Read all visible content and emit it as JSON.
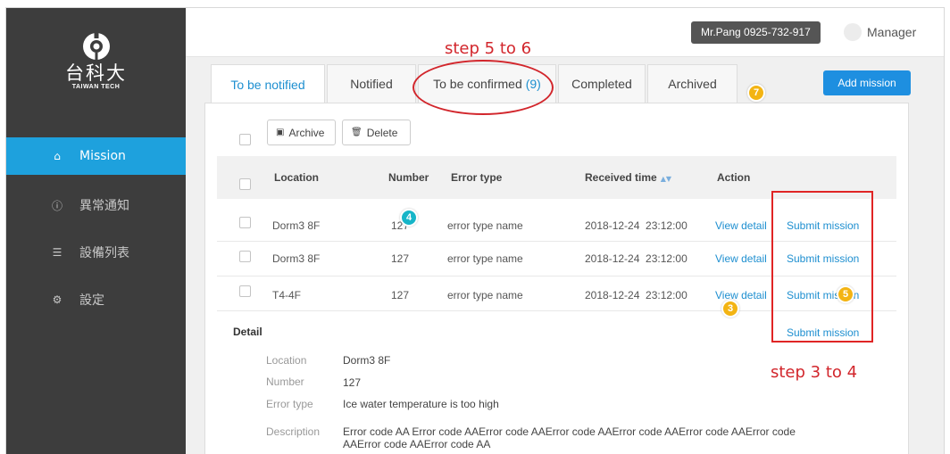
{
  "app": {
    "logo_cn": "台科大",
    "logo_en": "TAIWAN TECH"
  },
  "sidebar": {
    "items": [
      {
        "label": "Mission",
        "icon": "home-icon",
        "active": true
      },
      {
        "label": "異常通知",
        "icon": "alert-circle-icon",
        "active": false
      },
      {
        "label": "設備列表",
        "icon": "list-icon",
        "active": false
      },
      {
        "label": "設定",
        "icon": "gear-icon",
        "active": false
      }
    ]
  },
  "topbar": {
    "user": "Mr.Pang 0925-732-917",
    "role": "Manager"
  },
  "tabs": [
    {
      "label": "To be notified",
      "count": "",
      "active": true
    },
    {
      "label": "Notified",
      "count": "",
      "active": false
    },
    {
      "label": "To be confirmed",
      "count": "(9)",
      "active": false
    },
    {
      "label": "Completed",
      "count": "",
      "active": false
    },
    {
      "label": "Archived",
      "count": "",
      "active": false
    }
  ],
  "toolbar": {
    "add_label": "Add mission",
    "archive_label": "Archive",
    "delete_label": "Delete"
  },
  "table": {
    "columns": [
      "Location",
      "Number",
      "Error type",
      "Received time",
      "Action"
    ],
    "rows": [
      {
        "location": "Dorm3 8F",
        "number": "127",
        "error_type": "error type name",
        "received": "2018-12-24  23:12:00",
        "view": "View detail",
        "submit": "Submit mission"
      },
      {
        "location": "Dorm3 8F",
        "number": "127",
        "error_type": "error type name",
        "received": "2018-12-24  23:12:00",
        "view": "View detail",
        "submit": "Submit mission"
      },
      {
        "location": "T4-4F",
        "number": "127",
        "error_type": "error type name",
        "received": "2018-12-24  23:12:00",
        "view": "View detail",
        "submit": "Submit mission"
      }
    ]
  },
  "detail": {
    "title": "Detail",
    "submit": "Submit mission",
    "fields": [
      {
        "label": "Location",
        "value": "Dorm3 8F"
      },
      {
        "label": "Number",
        "value": "127"
      },
      {
        "label": "Error type",
        "value": "Ice water temperature is too high"
      },
      {
        "label": "Description",
        "value": "Error code AA Error code AAError code AAError code AAError code AAError code AAError code AAError code AAError code AA"
      }
    ]
  },
  "annotations": {
    "step_top": "step 5 to 6",
    "step_right": "step 3 to 4",
    "markers": [
      "3",
      "4",
      "5",
      "7"
    ]
  },
  "colors": {
    "sidebar_bg": "#3d3d3d",
    "accent": "#1ea1dd",
    "link": "#1e8fd0",
    "annotation_red": "#d2262c",
    "marker_yellow": "#f3b413",
    "marker_teal": "#16b5c8"
  }
}
